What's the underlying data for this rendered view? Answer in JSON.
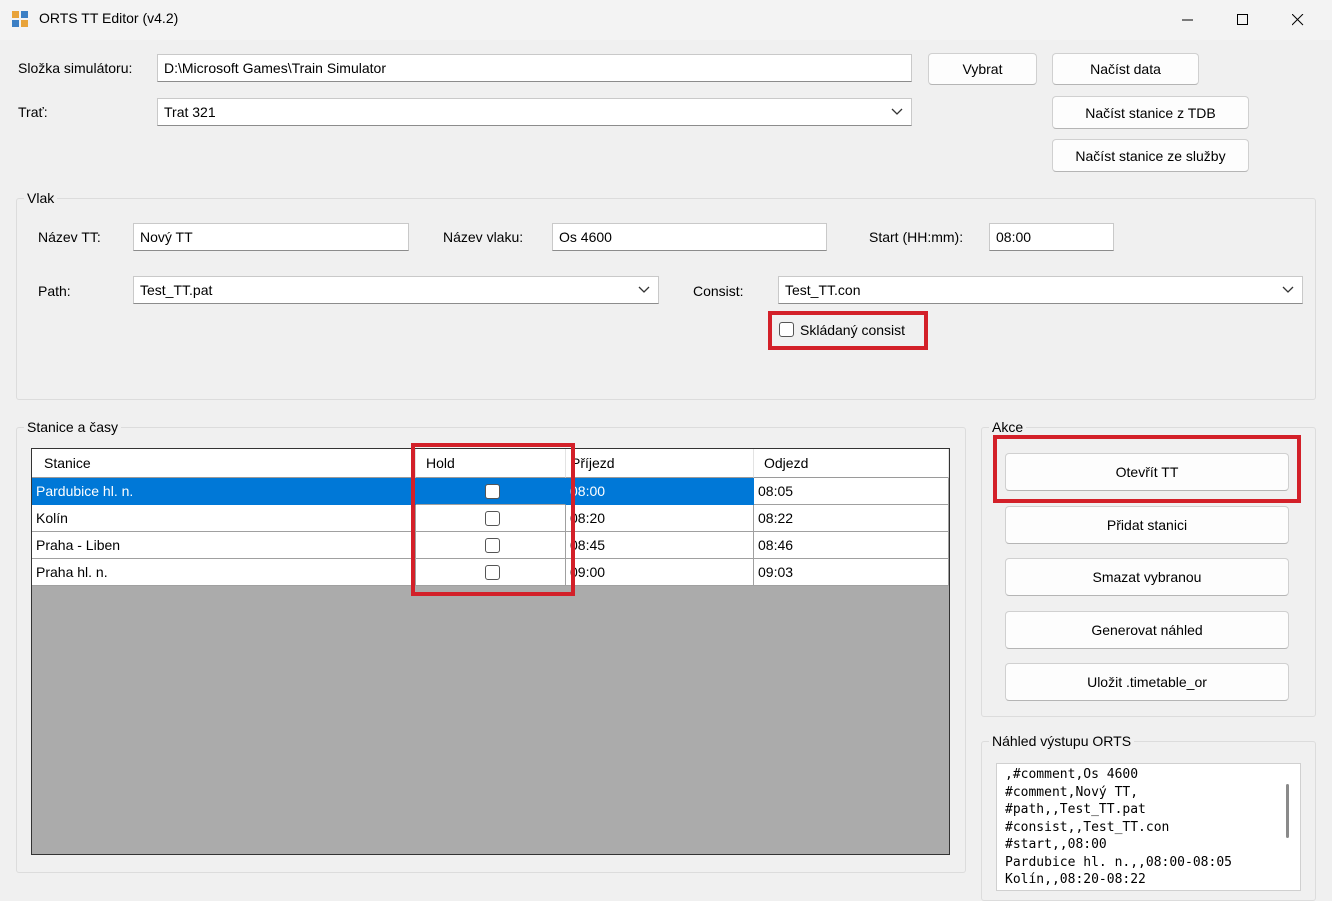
{
  "window": {
    "title": "ORTS TT Editor (v4.2)"
  },
  "top": {
    "sim_folder_label": "Složka simulátoru:",
    "sim_folder_value": "D:\\Microsoft Games\\Train Simulator",
    "route_label": "Trať:",
    "route_value": "Trat 321",
    "browse_button": "Vybrat",
    "load_data_button": "Načíst data",
    "load_stations_tdb_button": "Načíst stanice z TDB",
    "load_stations_service_button": "Načíst stanice ze služby"
  },
  "train": {
    "group_title": "Vlak",
    "tt_name_label": "Název TT:",
    "tt_name_value": "Nový TT",
    "train_name_label": "Název vlaku:",
    "train_name_value": "Os 4600",
    "start_label": "Start (HH:mm):",
    "start_value": "08:00",
    "path_label": "Path:",
    "path_value": "Test_TT.pat",
    "consist_label": "Consist:",
    "consist_value": "Test_TT.con",
    "composite_consist_label": "Skládaný consist",
    "composite_consist_checked": false
  },
  "stations": {
    "group_title": "Stanice a časy",
    "columns": [
      "Stanice",
      "Hold",
      "Příjezd",
      "Odjezd"
    ],
    "rows": [
      {
        "station": "Pardubice hl. n.",
        "hold": false,
        "arrival": "08:00",
        "departure": "08:05",
        "selected": true
      },
      {
        "station": "Kolín",
        "hold": false,
        "arrival": "08:20",
        "departure": "08:22",
        "selected": false
      },
      {
        "station": "Praha - Liben",
        "hold": false,
        "arrival": "08:45",
        "departure": "08:46",
        "selected": false
      },
      {
        "station": "Praha hl. n.",
        "hold": false,
        "arrival": "09:00",
        "departure": "09:03",
        "selected": false
      }
    ]
  },
  "actions": {
    "group_title": "Akce",
    "open_tt": "Otevřít TT",
    "add_station": "Přidat stanici",
    "delete_selected": "Smazat vybranou",
    "generate_preview": "Generovat náhled",
    "save_timetable": "Uložit .timetable_or"
  },
  "preview": {
    "group_title": "Náhled výstupu ORTS",
    "lines": [
      ",#comment,Os 4600",
      "#comment,Nový TT,",
      "#path,,Test_TT.pat",
      "#consist,,Test_TT.con",
      "#start,,08:00",
      "Pardubice hl. n.,,08:00-08:05",
      "Kolín,,08:20-08:22"
    ]
  },
  "colors": {
    "highlight_red": "#d32029",
    "selection_blue": "#0078d7",
    "grid_background": "#ababab"
  }
}
